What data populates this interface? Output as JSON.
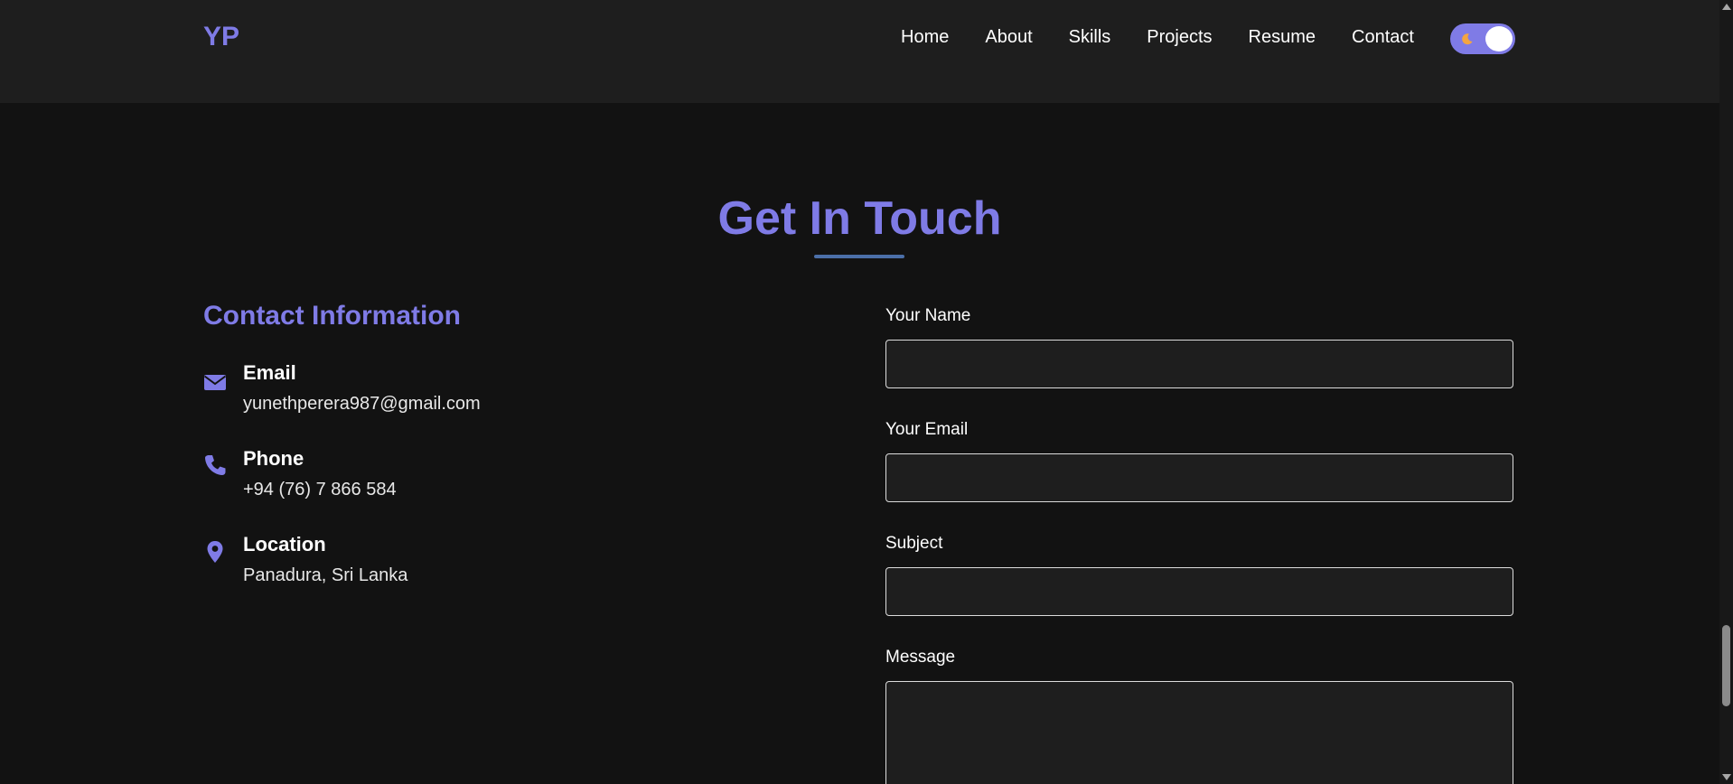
{
  "nav": {
    "logo": "YP",
    "links": [
      "Home",
      "About",
      "Skills",
      "Projects",
      "Resume",
      "Contact"
    ]
  },
  "theme_toggle": {
    "icon": "moon-icon",
    "state": "dark"
  },
  "section": {
    "title": "Get In Touch"
  },
  "contact_info": {
    "heading": "Contact Information",
    "items": [
      {
        "icon": "envelope-icon",
        "title": "Email",
        "value": "yunethperera987@gmail.com"
      },
      {
        "icon": "phone-icon",
        "title": "Phone",
        "value": "+94 (76) 7 866 584"
      },
      {
        "icon": "location-pin-icon",
        "title": "Location",
        "value": "Panadura, Sri Lanka"
      }
    ]
  },
  "form": {
    "name_label": "Your Name",
    "email_label": "Your Email",
    "subject_label": "Subject",
    "message_label": "Message"
  },
  "colors": {
    "accent": "#7f7be6",
    "background": "#121212",
    "surface": "#1e1e1e",
    "underline": "#4b6fa8"
  }
}
